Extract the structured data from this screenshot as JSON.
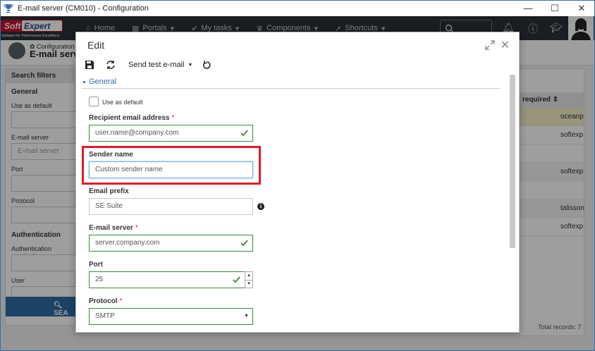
{
  "window": {
    "title": "E-mail server (CM010) - Configuration",
    "controls": {
      "minimize": "—",
      "maximize": "☐",
      "close": "✕"
    }
  },
  "header": {
    "logo_text": "SoftExpert",
    "logo_tagline": "Software for Performance Excellence",
    "nav": [
      {
        "label": "Home",
        "icon": "home-icon"
      },
      {
        "label": "Portals",
        "icon": "grid-icon"
      },
      {
        "label": "My tasks",
        "icon": "check-icon"
      },
      {
        "label": "Components",
        "icon": "trophy-icon"
      },
      {
        "label": "Shortcuts",
        "icon": "rocket-icon"
      }
    ]
  },
  "page": {
    "breadcrumb_small": "Configuration",
    "title": "E-mail server"
  },
  "left_panel": {
    "header": "Search filters",
    "general": "General",
    "use_as_default": "Use as default",
    "email_server": "E-mail server",
    "email_server_placeholder": "E-mail server",
    "port": "Port",
    "protocol": "Protocol",
    "authentication": "Authentication",
    "authentication_required": "Authentication required",
    "user": "User",
    "search_button": "SEA"
  },
  "right_table": {
    "column_header": "required",
    "rows": [
      "oceanp",
      "softexp",
      "",
      "softexp",
      "",
      "talisson",
      "softexp"
    ],
    "total": "Total records: 7"
  },
  "modal": {
    "title": "Edit",
    "toolbar": {
      "send_test": "Send test e-mail"
    },
    "section": "General",
    "use_as_default_label": "Use as default",
    "fields": {
      "recipient_label": "Recipient email address",
      "recipient_value": "user.name@company.com",
      "sender_label": "Sender name",
      "sender_placeholder": "Custom sender name",
      "prefix_label": "Email prefix",
      "prefix_value": "SE Suite",
      "server_label": "E-mail server",
      "server_value": "server.company.com",
      "port_label": "Port",
      "port_value": "25",
      "protocol_label": "Protocol",
      "protocol_value": "SMTP"
    },
    "required_mark": "*"
  },
  "colors": {
    "header_bg": "#2a3036",
    "accent": "#3a6ea5",
    "valid_border": "#3b8a3b",
    "highlight": "#e01b24"
  }
}
